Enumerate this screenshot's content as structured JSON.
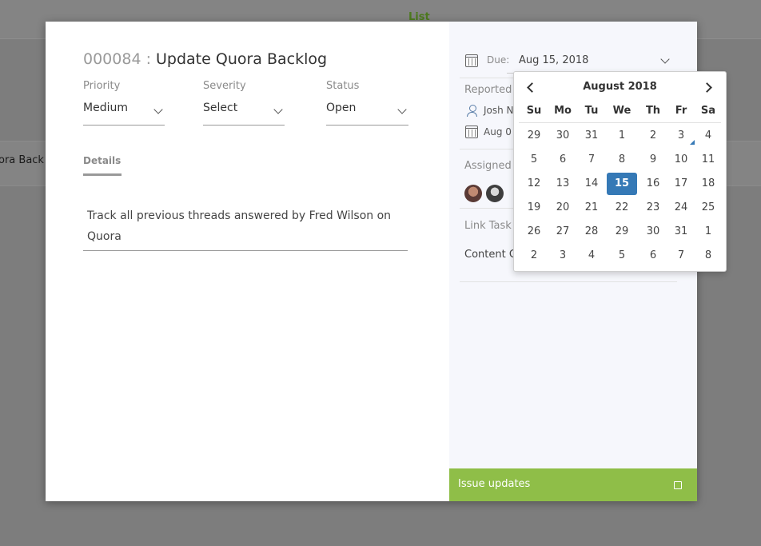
{
  "background": {
    "tab_label": "List",
    "row_text": "ora Back"
  },
  "issue": {
    "id": "000084",
    "separator": " : ",
    "title": "Update Quora Backlog"
  },
  "fields": [
    {
      "label": "Priority",
      "value": "Medium"
    },
    {
      "label": "Severity",
      "value": "Select"
    },
    {
      "label": "Status",
      "value": "Open"
    }
  ],
  "details": {
    "tab_label": "Details",
    "description": "Track all previous threads answered by Fred Wilson on Quora"
  },
  "side": {
    "due_label": "Due:",
    "due_value": "Aug 15, 2018",
    "reported_label": "Reported",
    "reporter": "Josh N",
    "reported_date": "Aug 0",
    "assigned_label": "Assigned",
    "link_label": "Link Task",
    "linked_item": "Content C",
    "issue_updates_label": "Issue updates"
  },
  "datepicker": {
    "month_label": "August 2018",
    "weekdays": [
      "Su",
      "Mo",
      "Tu",
      "We",
      "Th",
      "Fr",
      "Sa"
    ],
    "weeks": [
      [
        "29",
        "30",
        "31",
        "1",
        "2",
        "3",
        "4"
      ],
      [
        "5",
        "6",
        "7",
        "8",
        "9",
        "10",
        "11"
      ],
      [
        "12",
        "13",
        "14",
        "15",
        "16",
        "17",
        "18"
      ],
      [
        "19",
        "20",
        "21",
        "22",
        "23",
        "24",
        "25"
      ],
      [
        "26",
        "27",
        "28",
        "29",
        "30",
        "31",
        "1"
      ],
      [
        "2",
        "3",
        "4",
        "5",
        "6",
        "7",
        "8"
      ]
    ],
    "selected_day": "15",
    "today_day": "3"
  },
  "colors": {
    "accent_green": "#8fbe48",
    "selected_blue": "#3579b6",
    "tab_green": "#4d7a1e"
  }
}
